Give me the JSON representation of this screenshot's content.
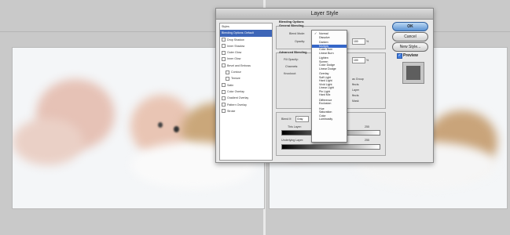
{
  "dialog": {
    "title": "Layer Style",
    "styles_header": "Styles",
    "styles": [
      {
        "label": "Blending Options: Default",
        "selected": true,
        "indent": false
      },
      {
        "label": "Drop Shadow",
        "indent": false
      },
      {
        "label": "Inner Shadow",
        "indent": false
      },
      {
        "label": "Outer Glow",
        "indent": false
      },
      {
        "label": "Inner Glow",
        "indent": false
      },
      {
        "label": "Bevel and Emboss",
        "indent": false
      },
      {
        "label": "Contour",
        "indent": true
      },
      {
        "label": "Texture",
        "indent": true
      },
      {
        "label": "Satin",
        "indent": false
      },
      {
        "label": "Color Overlay",
        "indent": false
      },
      {
        "label": "Gradient Overlay",
        "indent": false
      },
      {
        "label": "Pattern Overlay",
        "indent": false
      },
      {
        "label": "Stroke",
        "indent": false
      }
    ],
    "blending_options": {
      "heading": "Blending Options",
      "general_heading": "General Blending",
      "blend_mode_label": "Blend Mode:",
      "opacity_label": "Opacity:",
      "opacity_value": "100",
      "opacity_unit": "%",
      "advanced_heading": "Advanced Blending",
      "fill_opacity_label": "Fill Opacity:",
      "fill_opacity_value": "100",
      "channels_label": "Channels:",
      "knockout_label": "Knockout:",
      "option_1": "as Group",
      "option_2": "ffects",
      "option_3": "Layer",
      "option_4": "ffects",
      "option_5": "Mask",
      "blend_if_label": "Blend If:",
      "blend_if_value": "Gray",
      "this_layer_label": "This Layer:",
      "this_layer_value": "255",
      "underlying_label": "Underlying Layer:",
      "underlying_value": "255"
    },
    "buttons": {
      "ok": "OK",
      "cancel": "Cancel",
      "new_style": "New Style..."
    },
    "preview_label": "Preview"
  },
  "blend_mode_menu": {
    "groups": [
      [
        "Normal",
        "Dissolve"
      ],
      [
        "Darken",
        "Multiply",
        "Color Burn",
        "Linear Burn"
      ],
      [
        "Lighten",
        "Screen",
        "Color Dodge",
        "Linear Dodge"
      ],
      [
        "Overlay",
        "Soft Light",
        "Hard Light",
        "Vivid Light",
        "Linear Light",
        "Pin Light",
        "Hard Mix"
      ],
      [
        "Difference",
        "Exclusion"
      ],
      [
        "Hue",
        "Saturation",
        "Color",
        "Luminosity"
      ]
    ],
    "checked": "Normal",
    "highlighted": "Multiply"
  }
}
